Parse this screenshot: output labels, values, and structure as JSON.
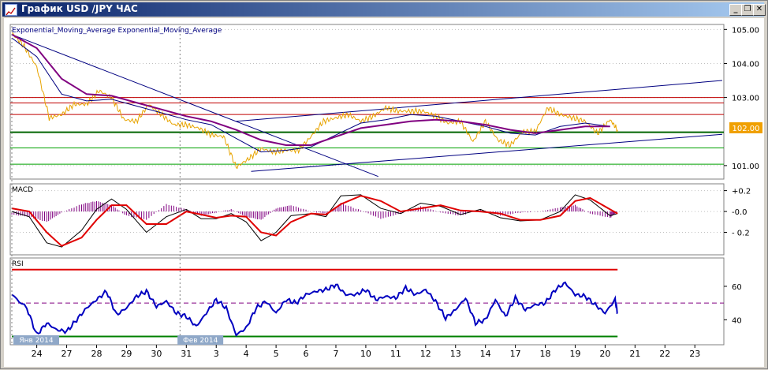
{
  "window": {
    "title": "График USD /JPY ЧАС",
    "minimize_icon": "minimize-icon",
    "restore_icon": "restore-icon",
    "close_icon": "close-icon"
  },
  "colors": {
    "price": "#e8a400",
    "ema_fast": "#000080",
    "ema_slow": "#800080",
    "support_resistance": "#c00000",
    "horizontal_green": "#00a000",
    "trend": "#000080",
    "macd_line": "#000000",
    "signal_line": "#e00000",
    "histogram": "#800080",
    "rsi": "#0000c0",
    "rsi_upper": "#e00000",
    "rsi_lower": "#008000",
    "rsi_mid": "#800080",
    "price_tag_bg": "#f0a000"
  },
  "chart_data": [
    {
      "type": "line",
      "panel": "price",
      "title": "Exponential_Moving_Average Exponential_Moving_Average",
      "yaxis_ticks": [
        "105.00",
        "104.00",
        "103.00",
        "101.00"
      ],
      "ylim": [
        100.65,
        105.1
      ],
      "current_price_label": "102.00",
      "current_price": 102.0,
      "horizontal_levels_red": [
        103.0,
        102.84,
        102.5
      ],
      "horizontal_level_dark_green": 101.98,
      "horizontal_levels_green": [
        101.52,
        101.04
      ],
      "trendlines": [
        {
          "x0": 0,
          "y0": 104.85,
          "x1": 14.7,
          "y1": 100.68
        },
        {
          "x0": 9.0,
          "y0": 102.3,
          "x1": 28.5,
          "y1": 103.5
        },
        {
          "x0": 9.6,
          "y0": 100.83,
          "x1": 28.5,
          "y1": 101.92
        }
      ],
      "series": [
        {
          "role": "price",
          "x": [
            0,
            0.5,
            1,
            1.5,
            2,
            2.5,
            3,
            3.5,
            4,
            4.5,
            5,
            5.5,
            6,
            6.5,
            7,
            7.5,
            8,
            8.5,
            9,
            9.5,
            10,
            10.5,
            11,
            11.5,
            12,
            12.5,
            13,
            13.5,
            14,
            14.5,
            15,
            15.5,
            16,
            16.5,
            17,
            17.5,
            18,
            18.5,
            19,
            19.5,
            20,
            20.5,
            21,
            21.5,
            22,
            22.5,
            23,
            23.5,
            24,
            24.3
          ],
          "values": [
            104.9,
            104.5,
            103.9,
            102.4,
            102.5,
            102.8,
            102.8,
            103.2,
            103.0,
            102.35,
            102.3,
            102.8,
            102.5,
            102.2,
            102.2,
            102.1,
            101.9,
            101.85,
            100.95,
            101.2,
            101.5,
            101.4,
            101.45,
            101.45,
            101.85,
            102.3,
            102.4,
            102.5,
            102.3,
            102.45,
            102.7,
            102.6,
            102.6,
            102.6,
            102.45,
            102.25,
            102.3,
            101.7,
            102.3,
            101.75,
            101.6,
            102.0,
            102.0,
            102.7,
            102.5,
            102.4,
            102.3,
            101.95,
            102.35,
            102.05
          ]
        },
        {
          "role": "ema_fast",
          "x": [
            0,
            1,
            2,
            3,
            4,
            5,
            6,
            7,
            8,
            9,
            10,
            11,
            12,
            13,
            14,
            15,
            16,
            17,
            18,
            19,
            20,
            21,
            22,
            23,
            24
          ],
          "values": [
            104.75,
            104.2,
            103.1,
            102.9,
            102.95,
            102.75,
            102.55,
            102.35,
            102.2,
            101.8,
            101.4,
            101.45,
            101.55,
            101.9,
            102.25,
            102.35,
            102.5,
            102.45,
            102.3,
            102.15,
            101.95,
            101.9,
            102.15,
            102.25,
            102.15
          ]
        },
        {
          "role": "ema_slow",
          "x": [
            0,
            1,
            2,
            3,
            4,
            5,
            6,
            7,
            8,
            9,
            10,
            11,
            12,
            13,
            14,
            15,
            16,
            17,
            18,
            19,
            20,
            21,
            22,
            23,
            24
          ],
          "values": [
            104.85,
            104.45,
            103.55,
            103.1,
            103.05,
            102.85,
            102.65,
            102.45,
            102.3,
            102.05,
            101.75,
            101.6,
            101.6,
            101.85,
            102.1,
            102.2,
            102.3,
            102.35,
            102.3,
            102.2,
            102.05,
            101.95,
            102.05,
            102.15,
            102.15
          ]
        }
      ]
    },
    {
      "type": "line",
      "panel": "macd",
      "title": "MACD",
      "yaxis_ticks": [
        "+0.2",
        "-0.0",
        "- 0.2"
      ],
      "ylim": [
        -0.4,
        0.25
      ],
      "series": [
        {
          "role": "macd_line",
          "x": [
            0,
            0.7,
            1.4,
            2,
            2.8,
            3.4,
            4,
            4.6,
            5.4,
            6.2,
            7,
            7.6,
            8.2,
            8.8,
            9.4,
            10,
            10.6,
            11.2,
            12,
            12.6,
            13.2,
            14,
            14.8,
            15.6,
            16.4,
            17.2,
            18,
            18.8,
            19.6,
            20.4,
            21.2,
            22,
            22.6,
            23.2,
            24,
            24.3
          ],
          "values": [
            0.0,
            -0.05,
            -0.3,
            -0.34,
            -0.18,
            0.02,
            0.12,
            0.02,
            -0.2,
            -0.05,
            0.02,
            -0.07,
            -0.07,
            -0.02,
            -0.1,
            -0.28,
            -0.2,
            -0.04,
            -0.02,
            -0.05,
            0.15,
            0.16,
            0.03,
            -0.02,
            0.08,
            0.05,
            -0.03,
            0.02,
            -0.06,
            -0.09,
            -0.08,
            0.0,
            0.16,
            0.11,
            -0.04,
            -0.02
          ]
        },
        {
          "role": "signal_line",
          "x": [
            0,
            0.7,
            1.4,
            2,
            2.8,
            3.4,
            4,
            4.6,
            5.4,
            6.2,
            7,
            7.6,
            8.2,
            8.8,
            9.4,
            10,
            10.6,
            11.2,
            12,
            12.6,
            13.2,
            14,
            14.8,
            15.6,
            16.4,
            17.2,
            18,
            18.8,
            19.6,
            20.4,
            21.2,
            22,
            22.6,
            23.2,
            24,
            24.3
          ],
          "values": [
            0.03,
            0.0,
            -0.2,
            -0.33,
            -0.25,
            -0.08,
            0.06,
            0.06,
            -0.12,
            -0.12,
            0.0,
            -0.03,
            -0.06,
            -0.04,
            -0.05,
            -0.2,
            -0.23,
            -0.1,
            -0.02,
            -0.03,
            0.07,
            0.15,
            0.1,
            0.0,
            0.03,
            0.06,
            0.01,
            0.0,
            -0.02,
            -0.08,
            -0.08,
            -0.04,
            0.1,
            0.13,
            0.02,
            -0.02
          ]
        },
        {
          "role": "histogram",
          "x": [
            0,
            0.7,
            1.4,
            2,
            2.8,
            3.4,
            4,
            4.6,
            5.4,
            6.2,
            7,
            7.6,
            8.2,
            8.8,
            9.4,
            10,
            10.6,
            11.2,
            12,
            12.6,
            13.2,
            14,
            14.8,
            15.6,
            16.4,
            17.2,
            18,
            18.8,
            19.6,
            20.4,
            21.2,
            22,
            22.6,
            23.2,
            24,
            24.3
          ],
          "values": [
            -0.03,
            -0.05,
            -0.1,
            -0.01,
            0.07,
            0.1,
            0.06,
            -0.04,
            -0.08,
            0.07,
            0.02,
            -0.04,
            -0.01,
            0.02,
            -0.05,
            -0.08,
            0.03,
            0.06,
            0.0,
            -0.02,
            0.08,
            0.01,
            -0.07,
            -0.02,
            0.05,
            -0.01,
            -0.04,
            0.02,
            -0.04,
            -0.01,
            0.0,
            0.04,
            0.06,
            -0.02,
            -0.06,
            0.0
          ]
        }
      ]
    },
    {
      "type": "line",
      "panel": "rsi",
      "title": "RSI",
      "yaxis_ticks": [
        "60",
        "40"
      ],
      "ylim": [
        26,
        76
      ],
      "levels": {
        "upper": 70,
        "mid": 50,
        "lower": 30
      },
      "series": [
        {
          "role": "rsi",
          "x": [
            0,
            0.6,
            1,
            1.4,
            1.8,
            2.2,
            2.6,
            3,
            3.4,
            3.8,
            4.2,
            4.6,
            5,
            5.4,
            5.8,
            6.2,
            6.6,
            7,
            7.4,
            7.8,
            8.2,
            8.6,
            9,
            9.4,
            9.8,
            10.2,
            10.6,
            11,
            11.4,
            11.8,
            12.2,
            12.6,
            13,
            13.4,
            13.8,
            14.2,
            14.6,
            15,
            15.4,
            15.8,
            16.2,
            16.6,
            17,
            17.4,
            17.8,
            18.2,
            18.6,
            19,
            19.4,
            19.8,
            20.2,
            20.6,
            21,
            21.4,
            21.8,
            22.2,
            22.6,
            23,
            23.4,
            23.8,
            24.2,
            24.3
          ],
          "values": [
            55,
            47,
            31,
            38,
            34,
            33,
            40,
            47,
            52,
            57,
            43,
            47,
            54,
            57,
            48,
            51,
            44,
            42,
            36,
            44,
            52,
            47,
            31,
            35,
            47,
            51,
            44,
            52,
            50,
            55,
            57,
            58,
            61,
            55,
            55,
            58,
            52,
            54,
            53,
            59,
            55,
            58,
            51,
            41,
            46,
            53,
            38,
            40,
            52,
            42,
            53,
            46,
            49,
            50,
            58,
            62,
            55,
            54,
            49,
            44,
            52,
            44
          ]
        }
      ]
    }
  ],
  "xaxis": {
    "ticks": [
      "24",
      "27",
      "28",
      "29",
      "30",
      "31",
      "3",
      "4",
      "5",
      "6",
      "7",
      "10",
      "11",
      "12",
      "13",
      "14",
      "17",
      "18",
      "19",
      "20",
      "21",
      "22",
      "23"
    ],
    "month_labels": [
      "Янв 2014",
      "Фев 2014"
    ]
  }
}
